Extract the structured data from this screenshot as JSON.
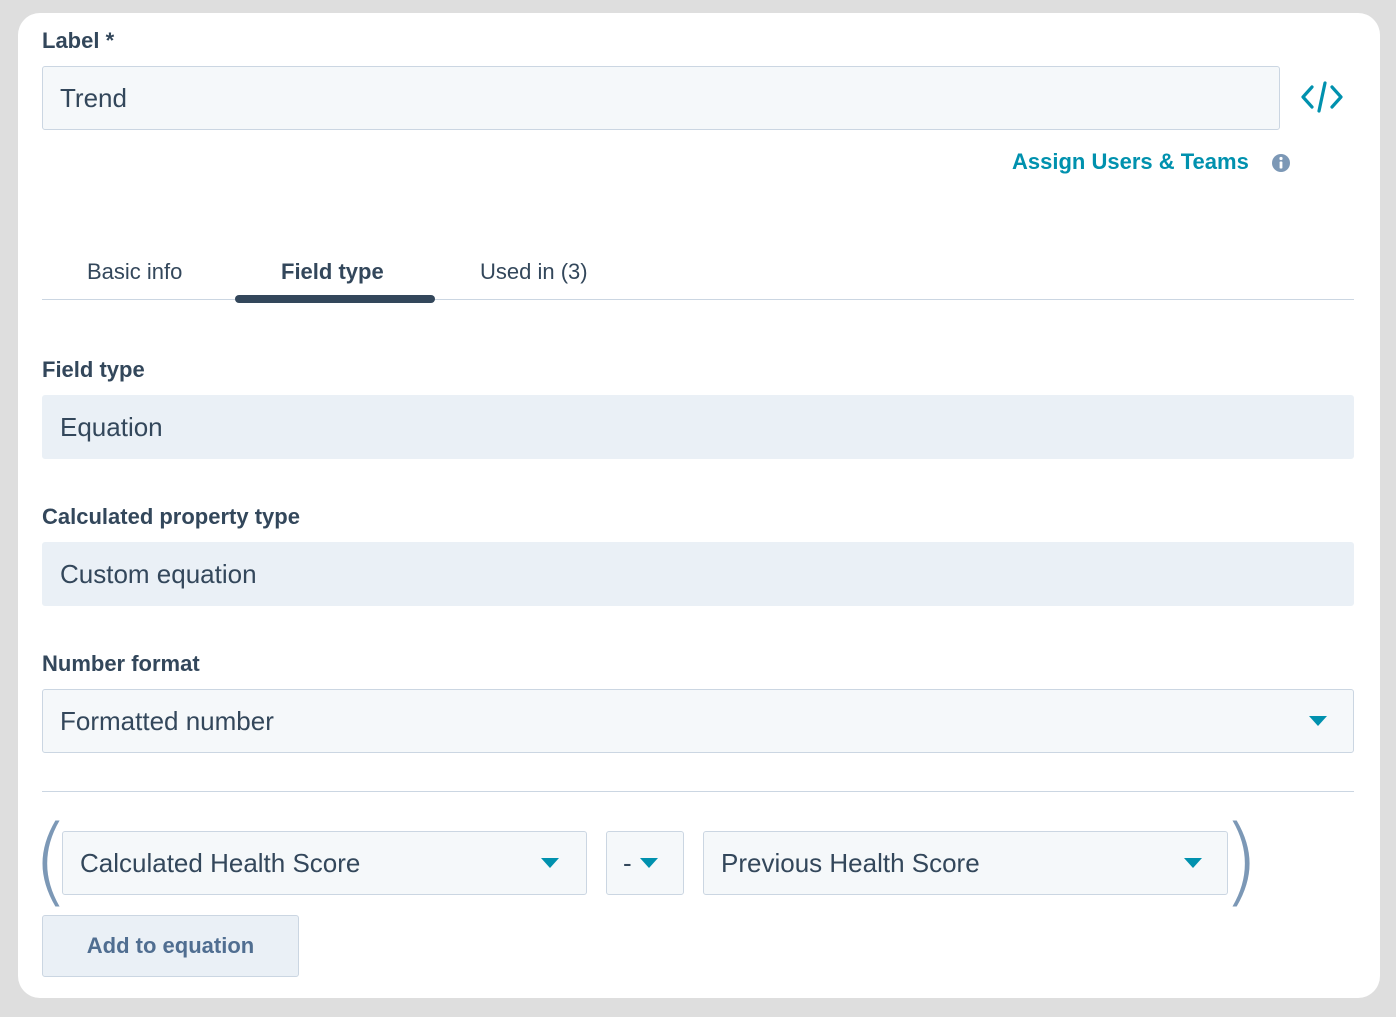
{
  "label_section": {
    "label": "Label *",
    "value": "Trend",
    "code_icon": "code-icon"
  },
  "assign": {
    "link_text": "Assign Users & Teams",
    "info_icon": "info-icon"
  },
  "tabs": [
    {
      "label": "Basic info",
      "active": false
    },
    {
      "label": "Field type",
      "active": true
    },
    {
      "label": "Used in (3)",
      "active": false
    }
  ],
  "field_type": {
    "label": "Field type",
    "value": "Equation"
  },
  "calculated_property_type": {
    "label": "Calculated property type",
    "value": "Custom equation"
  },
  "number_format": {
    "label": "Number format",
    "selected": "Formatted number"
  },
  "equation": {
    "left_operand": "Calculated Health Score",
    "operator": "-",
    "right_operand": "Previous Health Score",
    "open_paren": "(",
    "close_paren": ")",
    "add_button": "Add to equation"
  },
  "colors": {
    "accent": "#0091ae",
    "text": "#33475b",
    "border": "#cbd6e2"
  }
}
